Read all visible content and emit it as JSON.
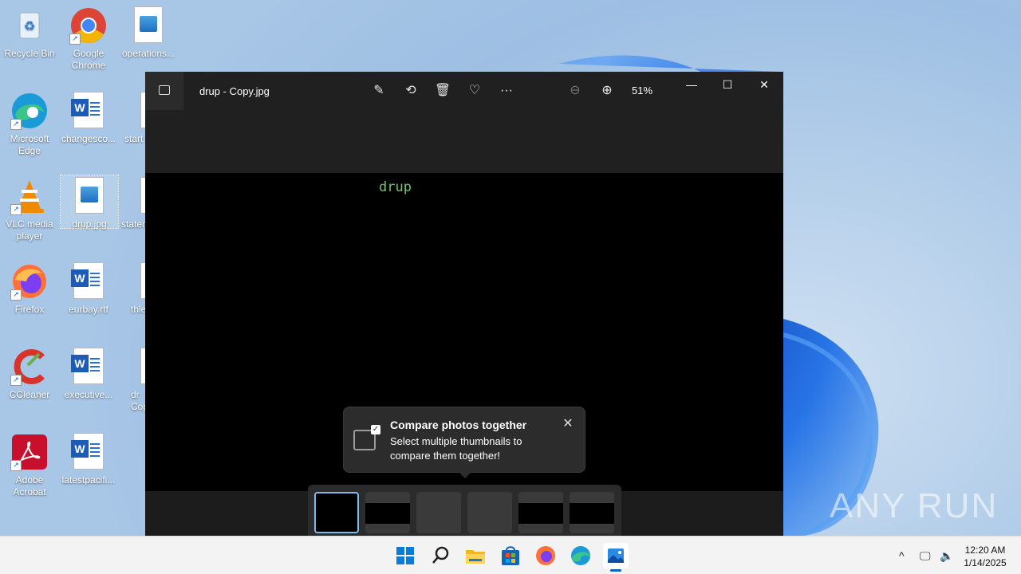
{
  "desktop": {
    "icons": [
      {
        "label": "Recycle Bin"
      },
      {
        "label": "Google Chrome"
      },
      {
        "label": "operations..."
      },
      {
        "label": "Microsoft Edge"
      },
      {
        "label": "changesco..."
      },
      {
        "label": "start"
      },
      {
        "label": "VLC media player"
      },
      {
        "label": "drup.jpg"
      },
      {
        "label": "staten"
      },
      {
        "label": "Firefox"
      },
      {
        "label": "eurbay.rtf"
      },
      {
        "label": "thle"
      },
      {
        "label": "CCleaner"
      },
      {
        "label": "executive..."
      },
      {
        "label": "dr Copy"
      },
      {
        "label": "Adobe Acrobat"
      },
      {
        "label": "latestpacifi..."
      }
    ]
  },
  "photos_window": {
    "title": "drup - Copy.jpg",
    "zoom": "51%",
    "toolbar_icons": [
      "edit-icon",
      "rotate-icon",
      "delete-icon",
      "favorite-icon",
      "more-icon",
      "zoom-out-icon",
      "zoom-in-icon"
    ],
    "photo_text": "drup",
    "teaching_tip": {
      "title": "Compare photos together",
      "body": "Select multiple thumbnails to compare them together!"
    },
    "thumbnails": 6
  },
  "taskbar": {
    "time": "12:20 AM",
    "date": "1/14/2025"
  },
  "watermark": "ANY RUN",
  "colors": {
    "accent": "#0067c0",
    "photo_text": "#6fc36f",
    "titlebar": "#202020"
  }
}
